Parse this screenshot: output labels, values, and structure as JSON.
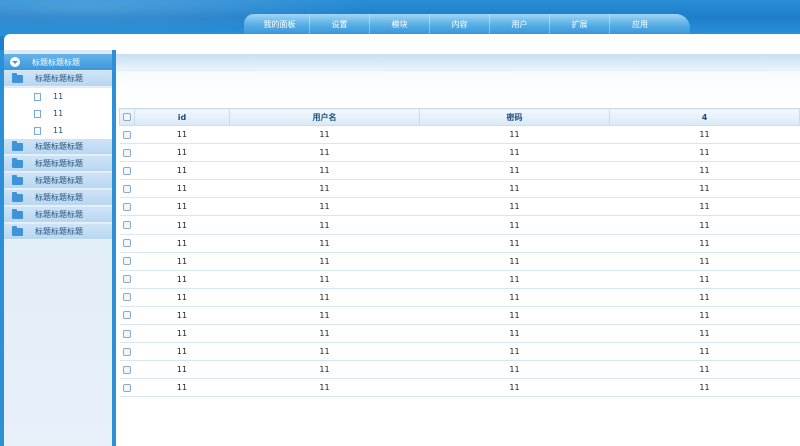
{
  "nav": {
    "items": [
      "我的面板",
      "设置",
      "模块",
      "内容",
      "用户",
      "扩展",
      "应用"
    ]
  },
  "sidebar": {
    "header": "标题标题标题",
    "group1": "标题标题标题",
    "children": [
      "11",
      "11",
      "11"
    ],
    "groups": [
      "标题标题标题",
      "标题标题标题",
      "标题标题标题",
      "标题标题标题",
      "标题标题标题",
      "标题标题标题"
    ]
  },
  "table": {
    "columns": [
      "id",
      "用户名",
      "密码",
      "4"
    ],
    "rows": [
      [
        "11",
        "11",
        "11",
        "11"
      ],
      [
        "11",
        "11",
        "11",
        "11"
      ],
      [
        "11",
        "11",
        "11",
        "11"
      ],
      [
        "11",
        "11",
        "11",
        "11"
      ],
      [
        "11",
        "11",
        "11",
        "11"
      ],
      [
        "11",
        "11",
        "11",
        "11"
      ],
      [
        "11",
        "11",
        "11",
        "11"
      ],
      [
        "11",
        "11",
        "11",
        "11"
      ],
      [
        "11",
        "11",
        "11",
        "11"
      ],
      [
        "11",
        "11",
        "11",
        "11"
      ],
      [
        "11",
        "11",
        "11",
        "11"
      ],
      [
        "11",
        "11",
        "11",
        "11"
      ],
      [
        "11",
        "11",
        "11",
        "11"
      ],
      [
        "11",
        "11",
        "11",
        "11"
      ],
      [
        "11",
        "11",
        "11",
        "11"
      ]
    ]
  }
}
